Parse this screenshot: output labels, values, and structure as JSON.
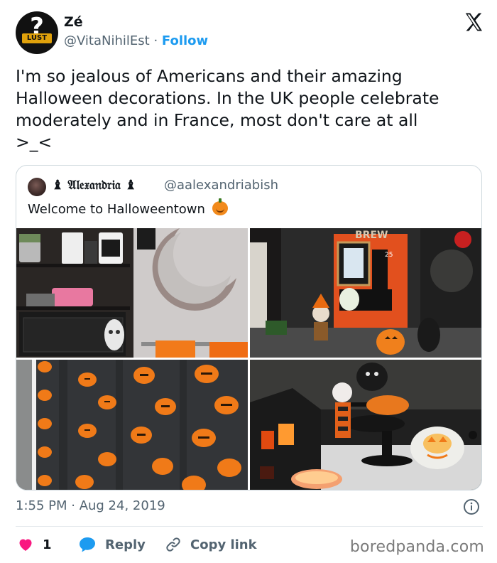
{
  "author": {
    "name": "Zé",
    "handle": "@VitaNihilEst",
    "separator": "·",
    "follow_label": "Follow",
    "avatar_text": "LUST"
  },
  "tweet": {
    "lines": [
      "I'm so jealous of Americans and their amazing",
      "Halloween decorations. In the UK people celebrate",
      "moderately and in France, most don't care at all",
      ">_<"
    ]
  },
  "quoted": {
    "name": "♝ 𝔄𝔩𝔢𝔵𝔞𝔫𝔡𝔯𝔦𝔞 ♝",
    "handle": "@aalexandriabish",
    "text": "Welcome to Halloweentown"
  },
  "timestamp": "1:55 PM · Aug 24, 2019",
  "actions": {
    "like_count": "1",
    "reply_label": "Reply",
    "copy_label": "Copy link"
  },
  "watermark": "boredpanda.com",
  "colors": {
    "accent": "#1d9bf0",
    "like": "#f91880",
    "muted": "#536471"
  },
  "icons": [
    "x-logo-icon",
    "info-icon",
    "heart-icon",
    "reply-bubble-icon",
    "link-icon"
  ]
}
